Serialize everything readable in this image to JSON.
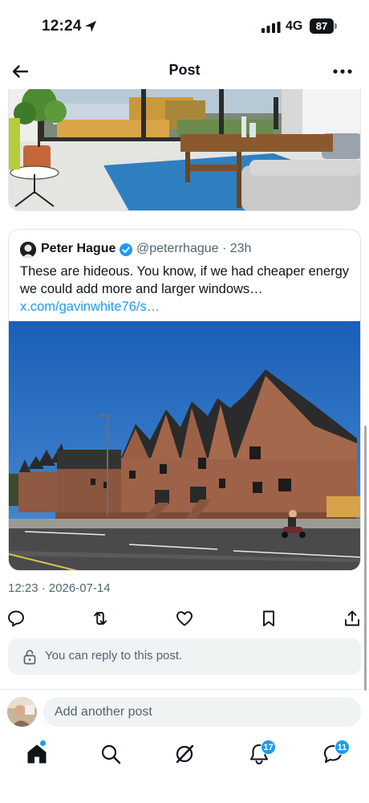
{
  "status_bar": {
    "time": "12:24",
    "network": "4G",
    "battery": "87"
  },
  "header": {
    "title": "Post"
  },
  "quote": {
    "name": "Peter Hague",
    "handle_time": "@peterrhague · 23h",
    "text": "These are hideous. You know, if we had cheaper energy we could add more and larger windows…",
    "link": "x.com/gavinwhite76/s…"
  },
  "post": {
    "timestamp": "12:23 · 2026-07-14"
  },
  "actions": [
    "reply-icon",
    "repost-icon",
    "like-icon",
    "bookmark-icon",
    "share-icon"
  ],
  "reply_notice": {
    "text": "You can reply to this post."
  },
  "compose": {
    "placeholder": "Add another post"
  },
  "tabbar": {
    "notifications_badge": "17",
    "messages_badge": "11"
  },
  "colors": {
    "accent": "#1d9bf0",
    "text_primary": "#0f1419",
    "text_secondary": "#536471",
    "surface": "#eff3f4"
  }
}
